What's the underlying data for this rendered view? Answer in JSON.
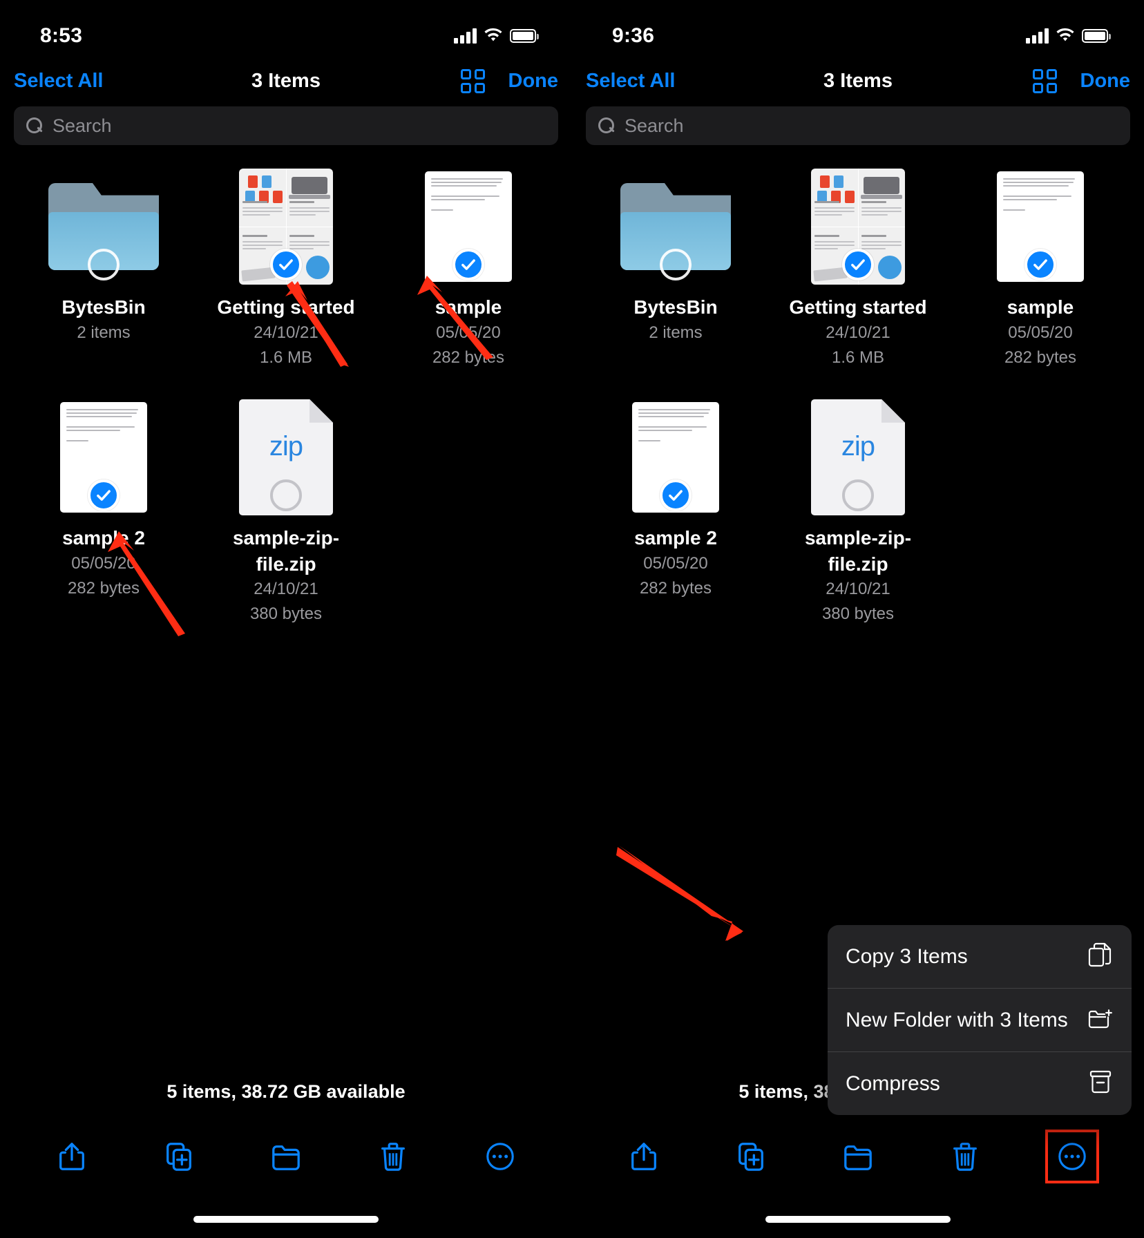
{
  "accent_blue": "#0a84ff",
  "arrow_color": "#ff2d14",
  "highlight_color": "#ff2d14",
  "screens": [
    {
      "id": "left",
      "status": {
        "time": "8:53",
        "signal_icon": "cellular-bars-icon",
        "wifi_icon": "wifi-icon",
        "battery_icon": "battery-full-icon"
      },
      "nav": {
        "select_all": "Select All",
        "title": "3 Items",
        "grid_icon": "grid-view-icon",
        "done": "Done"
      },
      "search": {
        "placeholder": "Search",
        "icon": "search-icon"
      },
      "files": [
        {
          "name": "BytesBin",
          "meta1": "2 items",
          "meta2": "",
          "kind": "folder",
          "selected": false
        },
        {
          "name": "Getting started",
          "meta1": "24/10/21",
          "meta2": "1.6 MB",
          "kind": "guide",
          "selected": true
        },
        {
          "name": "sample",
          "meta1": "05/05/20",
          "meta2": "282 bytes",
          "kind": "doc",
          "selected": true
        },
        {
          "name": "sample 2",
          "meta1": "05/05/20",
          "meta2": "282 bytes",
          "kind": "doc",
          "selected": true
        },
        {
          "name": "sample-zip-file.zip",
          "meta1": "24/10/21",
          "meta2": "380 bytes",
          "kind": "zip",
          "selected": false,
          "zip_label": "zip"
        }
      ],
      "storage": "5 items, 38.72 GB available",
      "toolbar": [
        {
          "name": "share-icon",
          "label": "Share"
        },
        {
          "name": "duplicate-icon",
          "label": "Duplicate"
        },
        {
          "name": "new-folder-icon",
          "label": "New Folder"
        },
        {
          "name": "trash-icon",
          "label": "Delete"
        },
        {
          "name": "more-ellipsis-icon",
          "label": "More"
        }
      ],
      "menu": null
    },
    {
      "id": "right",
      "status": {
        "time": "9:36",
        "signal_icon": "cellular-bars-icon",
        "wifi_icon": "wifi-icon",
        "battery_icon": "battery-full-icon"
      },
      "nav": {
        "select_all": "Select All",
        "title": "3 Items",
        "grid_icon": "grid-view-icon",
        "done": "Done"
      },
      "search": {
        "placeholder": "Search",
        "icon": "search-icon"
      },
      "files": [
        {
          "name": "BytesBin",
          "meta1": "2 items",
          "meta2": "",
          "kind": "folder",
          "selected": false
        },
        {
          "name": "Getting started",
          "meta1": "24/10/21",
          "meta2": "1.6 MB",
          "kind": "guide",
          "selected": true
        },
        {
          "name": "sample",
          "meta1": "05/05/20",
          "meta2": "282 bytes",
          "kind": "doc",
          "selected": true
        },
        {
          "name": "sample 2",
          "meta1": "05/05/20",
          "meta2": "282 bytes",
          "kind": "doc",
          "selected": true
        },
        {
          "name": "sample-zip-file.zip",
          "meta1": "24/10/21",
          "meta2": "380 bytes",
          "kind": "zip",
          "selected": false,
          "zip_label": "zip"
        }
      ],
      "storage": "5 items, 38.72 GB available",
      "toolbar": [
        {
          "name": "share-icon",
          "label": "Share"
        },
        {
          "name": "duplicate-icon",
          "label": "Duplicate"
        },
        {
          "name": "new-folder-icon",
          "label": "New Folder"
        },
        {
          "name": "trash-icon",
          "label": "Delete"
        },
        {
          "name": "more-ellipsis-icon",
          "label": "More"
        }
      ],
      "menu": {
        "items": [
          {
            "label": "Copy 3 Items",
            "icon": "copy-documents-icon"
          },
          {
            "label": "New Folder with 3 Items",
            "icon": "folder-plus-icon"
          },
          {
            "label": "Compress",
            "icon": "archive-box-icon"
          }
        ]
      }
    }
  ]
}
